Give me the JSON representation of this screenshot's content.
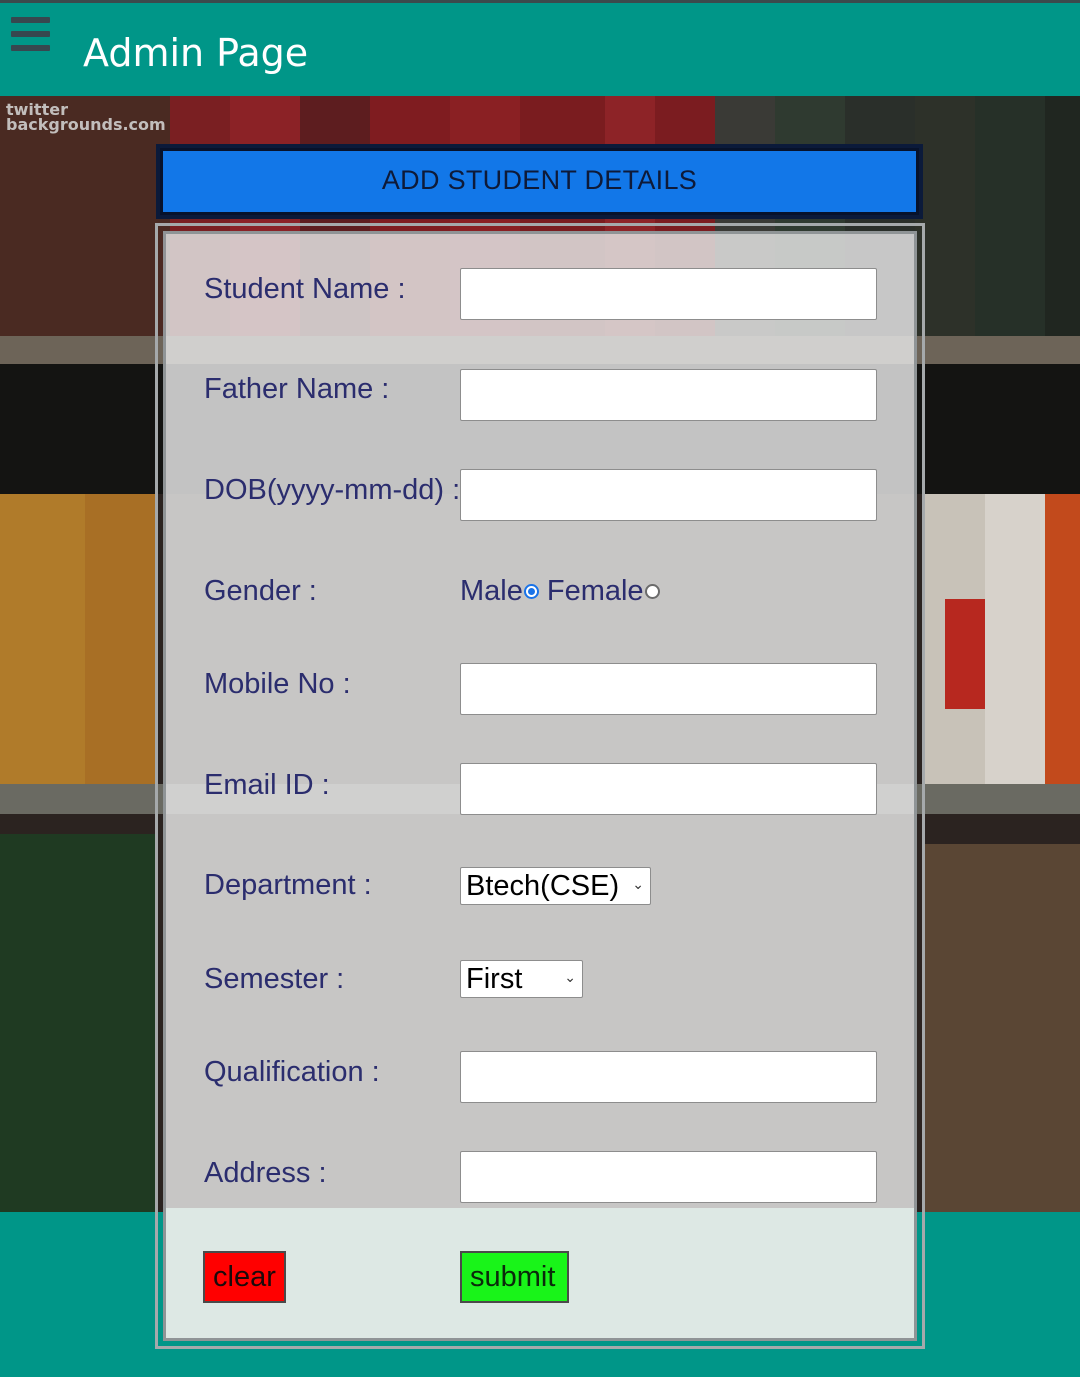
{
  "appbar": {
    "title": "Admin Page",
    "menu_icon": "hamburger-menu-icon"
  },
  "background": {
    "brand_line1": "twitter",
    "brand_line2": "backgrounds.com"
  },
  "form": {
    "heading": "ADD STUDENT DETAILS",
    "fields": {
      "student_name": {
        "label": "Student Name :",
        "value": ""
      },
      "father_name": {
        "label": "Father Name :",
        "value": ""
      },
      "dob": {
        "label": "DOB(yyyy-mm-dd) :",
        "value": ""
      },
      "gender": {
        "label": "Gender :",
        "option_male": "Male",
        "option_female": "Female",
        "selected": "Male"
      },
      "mobile": {
        "label": "Mobile No :",
        "value": ""
      },
      "email": {
        "label": "Email ID :",
        "value": ""
      },
      "department": {
        "label": "Department :",
        "selected": "Btech(CSE)"
      },
      "semester": {
        "label": "Semester :",
        "selected": "First"
      },
      "qualification": {
        "label": "Qualification :",
        "value": ""
      },
      "address": {
        "label": "Address :",
        "value": ""
      }
    },
    "buttons": {
      "clear": "clear",
      "submit": "submit"
    }
  },
  "colors": {
    "appbar": "#009688",
    "heading_bg": "#1277e8",
    "label_text": "#2b2d6e",
    "clear_button": "#ff0000",
    "submit_button": "#19f419"
  }
}
